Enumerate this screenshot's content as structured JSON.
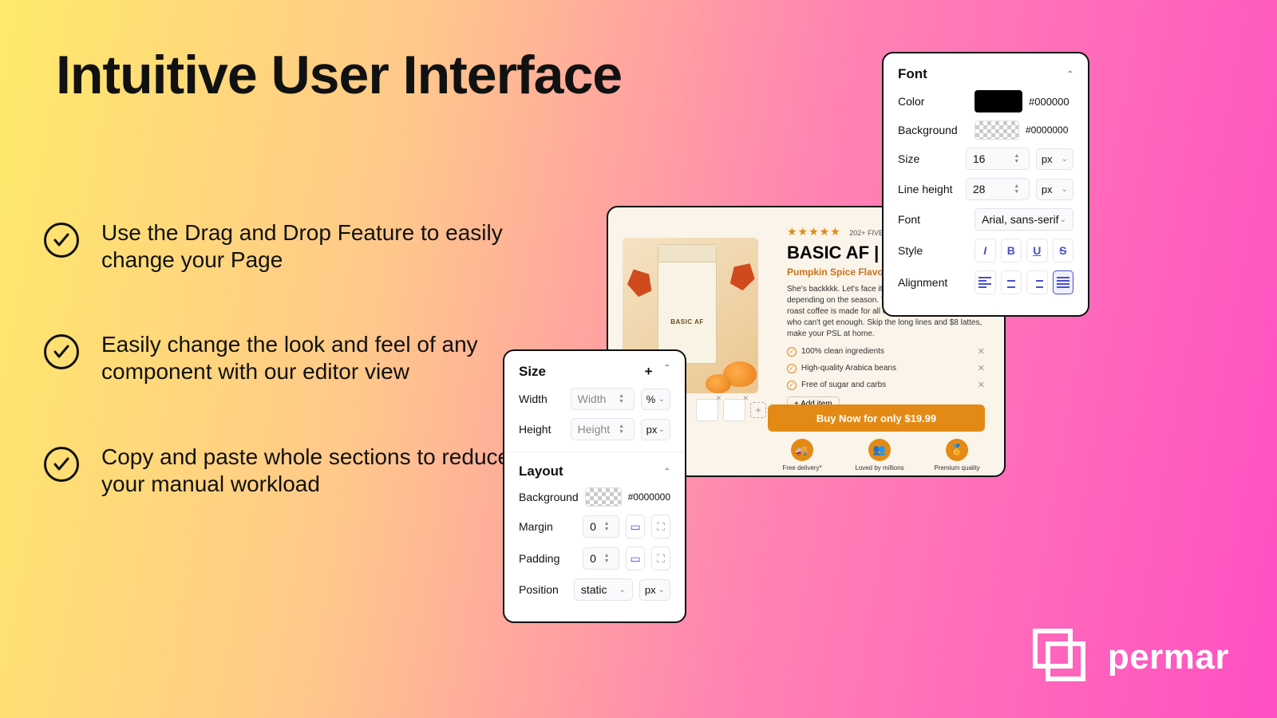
{
  "title": "Intuitive User Interface",
  "bullets": [
    "Use the Drag and Drop Feature to easily change your Page",
    "Easily change the look and feel of any component with our editor view",
    "Copy and paste whole sections to reduce your manual workload"
  ],
  "size_panel": {
    "title": "Size",
    "width_label": "Width",
    "width_placeholder": "Width",
    "width_unit": "%",
    "height_label": "Height",
    "height_placeholder": "Height",
    "height_unit": "px"
  },
  "layout_panel": {
    "title": "Layout",
    "background_label": "Background",
    "background_value": "#0000000",
    "margin_label": "Margin",
    "margin_value": "0",
    "padding_label": "Padding",
    "padding_value": "0",
    "position_label": "Position",
    "position_value": "static",
    "position_unit": "px"
  },
  "font_panel": {
    "title": "Font",
    "color_label": "Color",
    "color_value": "#000000",
    "background_label": "Background",
    "background_value": "#0000000",
    "size_label": "Size",
    "size_value": "16",
    "size_unit": "px",
    "lineheight_label": "Line height",
    "lineheight_value": "28",
    "lineheight_unit": "px",
    "font_label": "Font",
    "font_value": "Arial, sans-serif",
    "style_label": "Style",
    "alignment_label": "Alignment"
  },
  "preview": {
    "review_text": "202+ FIVE-STAR REVIEWS",
    "title": "BASIC AF | 12OZ",
    "subtitle": "Pumpkin Spice Flavored Ground Coffee",
    "description": "She's backkkk. Let's face it. We're all a little basic depending on the season. This 100% Arabica medium-roast coffee is made for all our fall loving coffee lovers who can't get enough. Skip the long lines and $8 lattes, make your PSL at home.",
    "features": [
      "100% clean ingredients",
      "High-quality Arabica beans",
      "Free of sugar and carbs"
    ],
    "add_item": "+ Add item",
    "bag_label": "BASIC AF",
    "buy_button": "Buy Now for only $19.99",
    "badges": [
      {
        "label": "Free delivery*"
      },
      {
        "label": "Loved by millions"
      },
      {
        "label": "Premium quality"
      }
    ]
  },
  "brand": "permar"
}
